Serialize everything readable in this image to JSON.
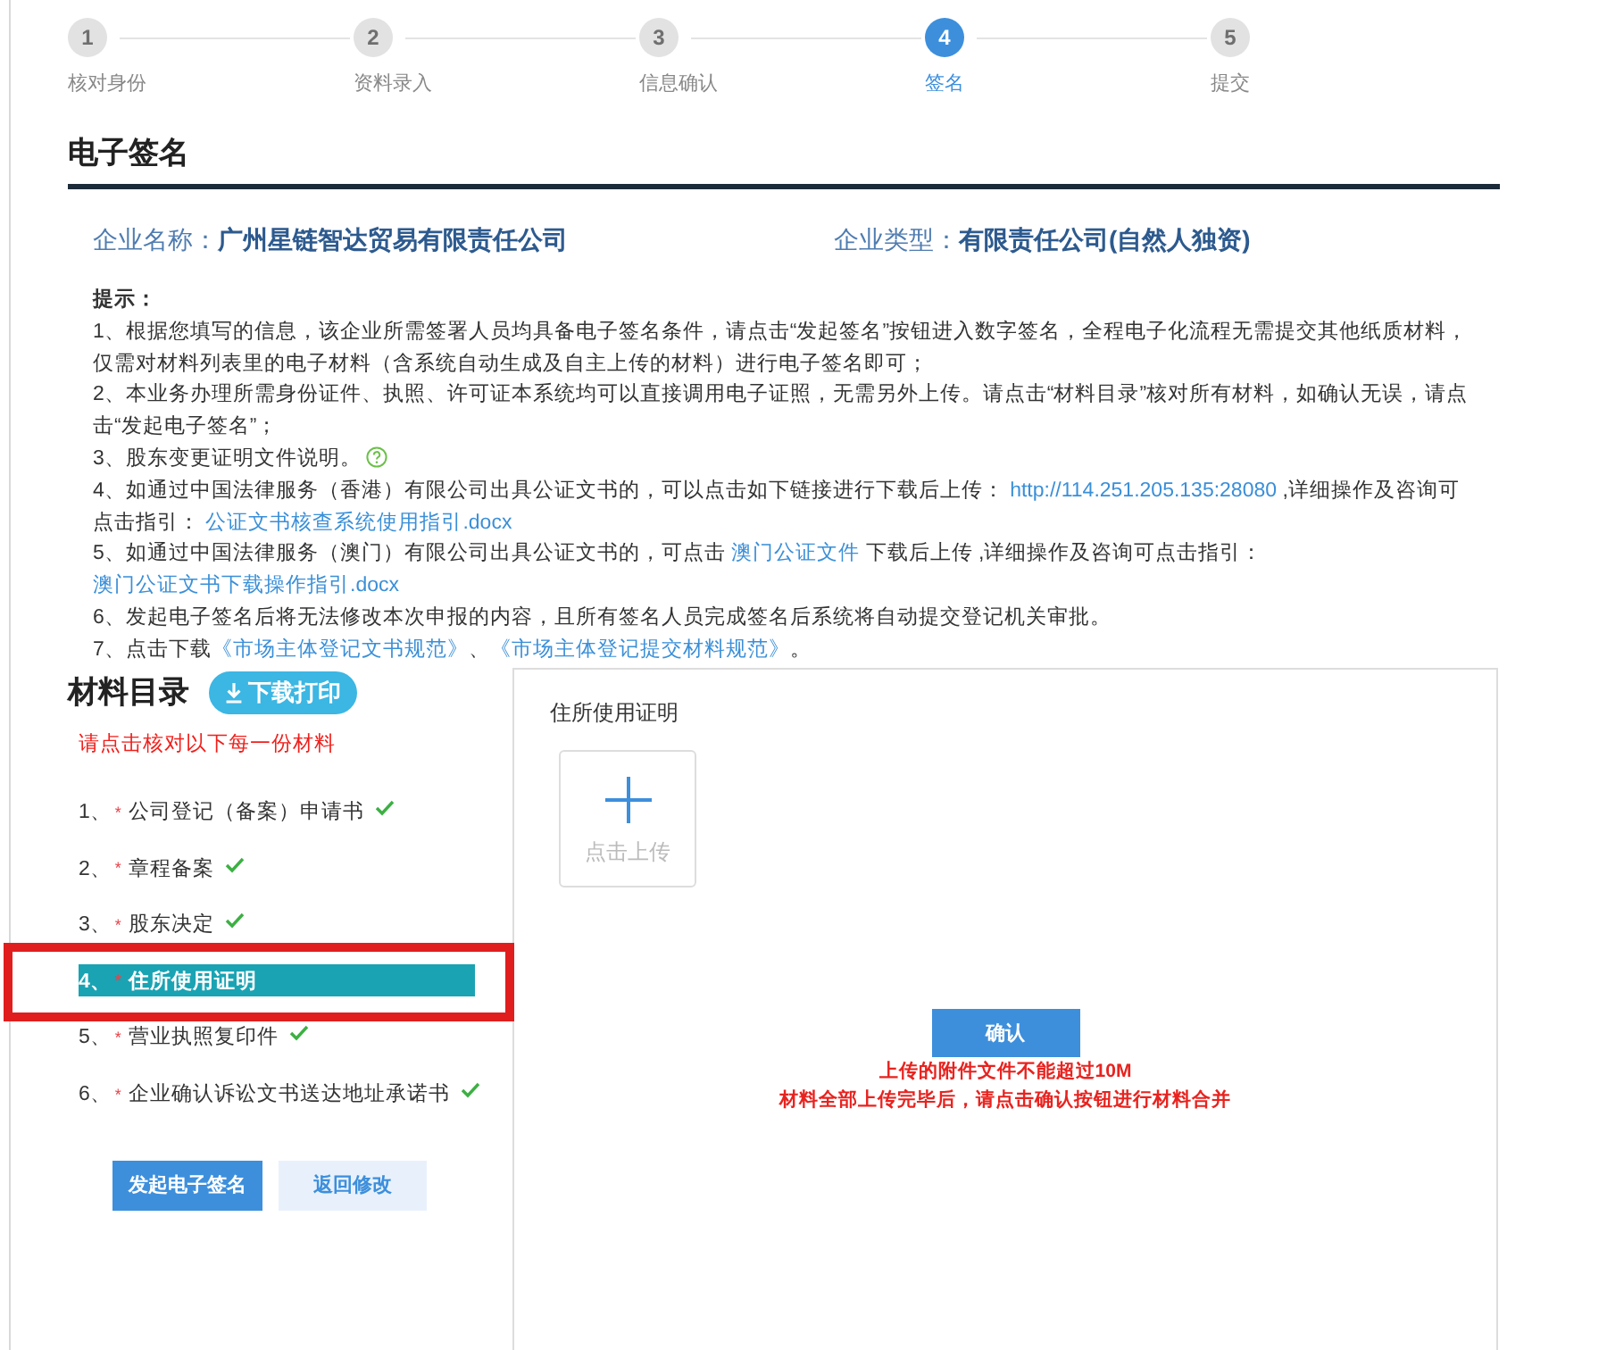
{
  "steps": [
    {
      "number": "1",
      "label": "核对身份",
      "selected": false
    },
    {
      "number": "2",
      "label": "资料录入",
      "selected": false
    },
    {
      "number": "3",
      "label": "信息确认",
      "selected": false
    },
    {
      "number": "4",
      "label": "签名",
      "selected": true
    },
    {
      "number": "5",
      "label": "提交",
      "selected": false
    }
  ],
  "section_title": "电子签名",
  "company": {
    "name_label": "企业名称：",
    "name": "广州星链智达贸易有限责任公司",
    "type_label": "企业类型：",
    "type": "有限责任公司(自然人独资)"
  },
  "tips": {
    "title": "提示：",
    "items": [
      {
        "segments": [
          {
            "kind": "text",
            "text": "1、根据您填写的信息，该企业所需签署人员均具备电子签名条件，请点击“发起签名”按钮进入数字签名，全程电子化流程无需提交其他纸质材料，仅需对材料列表里的电子材料（含系统自动生成及自主上传的材料）进行电子签名即可；"
          }
        ]
      },
      {
        "segments": [
          {
            "kind": "text",
            "text": "2、本业务办理所需身份证件、执照、许可证本系统均可以直接调用电子证照，无需另外上传。请点击“材料目录”核对所有材料，如确认无误，请点击“发起电子签名”；"
          }
        ]
      },
      {
        "segments": [
          {
            "kind": "text",
            "text": "3、股东变更证明文件说明。"
          },
          {
            "kind": "help_icon"
          }
        ]
      },
      {
        "segments": [
          {
            "kind": "text",
            "text": "4、如通过中国法律服务（香港）有限公司出具公证文书的，可以点击如下链接进行下载后上传： "
          },
          {
            "kind": "link",
            "text": "http://114.251.205.135:28080"
          },
          {
            "kind": "text",
            "text": " ,详细操作及咨询可点击指引： "
          },
          {
            "kind": "link",
            "text": "公证文书核查系统使用指引.docx"
          }
        ]
      },
      {
        "segments": [
          {
            "kind": "text",
            "text": "5、如通过中国法律服务（澳门）有限公司出具公证文书的，可点击 "
          },
          {
            "kind": "link",
            "text": "澳门公证文件"
          },
          {
            "kind": "text",
            "text": " 下载后上传 ,详细操作及咨询可点击指引： "
          },
          {
            "kind": "link",
            "text": "澳门公证文书下载操作指引.docx"
          }
        ]
      },
      {
        "segments": [
          {
            "kind": "text",
            "text": "6、发起电子签名后将无法修改本次申报的内容，且所有签名人员完成签名后系统将自动提交登记机关审批。"
          }
        ]
      },
      {
        "segments": [
          {
            "kind": "text",
            "text": "7、点击下载"
          },
          {
            "kind": "link",
            "text": "《市场主体登记文书规范》"
          },
          {
            "kind": "text",
            "text": "、"
          },
          {
            "kind": "link",
            "text": "《市场主体登记提交材料规范》"
          },
          {
            "kind": "text",
            "text": "。"
          }
        ]
      }
    ]
  },
  "materials": {
    "title": "材料目录",
    "download_button": "下载打印",
    "instruction": "请点击核对以下每一份材料",
    "items": [
      {
        "number": "1、",
        "mark": "*",
        "label": "公司登记（备案）申请书",
        "verified": true,
        "selected": false,
        "highlighted": false
      },
      {
        "number": "2、",
        "mark": "*",
        "label": "章程备案",
        "verified": true,
        "selected": false,
        "highlighted": false
      },
      {
        "number": "3、",
        "mark": "*",
        "label": "股东决定",
        "verified": true,
        "selected": false,
        "highlighted": false
      },
      {
        "number": "4、",
        "mark": "*",
        "label": "住所使用证明",
        "verified": false,
        "selected": true,
        "highlighted": true
      },
      {
        "number": "5、",
        "mark": "*",
        "label": "营业执照复印件",
        "verified": true,
        "selected": false,
        "highlighted": false
      },
      {
        "number": "6、",
        "mark": "*",
        "label": "企业确认诉讼文书送达地址承诺书",
        "verified": true,
        "selected": false,
        "highlighted": false
      }
    ],
    "buttons": [
      {
        "label": "发起电子签名",
        "kind": "primary"
      },
      {
        "label": "返回修改",
        "kind": "secondary"
      }
    ]
  },
  "upload_panel": {
    "title": "住所使用证明",
    "upload_label": "点击上传",
    "confirm_button": "确认",
    "notes": [
      "上传的附件文件不能超过10M",
      "材料全部上传完毕后，请点击确认按钮进行材料合并"
    ]
  }
}
